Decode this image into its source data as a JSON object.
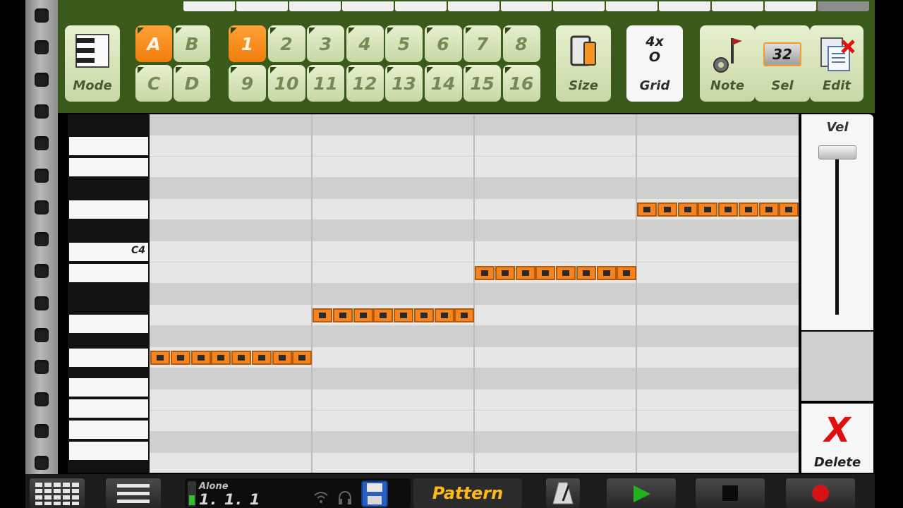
{
  "toolbar": {
    "mode_label": "Mode",
    "patterns": [
      "A",
      "B",
      "C",
      "D"
    ],
    "active_pattern": "A",
    "bars": [
      "1",
      "2",
      "3",
      "4",
      "5",
      "6",
      "7",
      "8",
      "9",
      "10",
      "11",
      "12",
      "13",
      "14",
      "15",
      "16"
    ],
    "active_bar": "1",
    "size_label": "Size",
    "grid_value_top": "4x",
    "grid_value_bottom": "O",
    "grid_label": "Grid",
    "note_label": "Note",
    "sel_value": "32",
    "sel_label": "Sel",
    "edit_label": "Edit"
  },
  "piano": {
    "c4_label": "C4"
  },
  "notes": [
    {
      "row": 11,
      "start_step": 0,
      "length_steps": 8
    },
    {
      "row": 9,
      "start_step": 8,
      "length_steps": 8
    },
    {
      "row": 7,
      "start_step": 16,
      "length_steps": 8
    },
    {
      "row": 4,
      "start_step": 24,
      "length_steps": 8
    }
  ],
  "vel_panel": {
    "label": "Vel"
  },
  "delete": {
    "icon": "X",
    "label": "Delete"
  },
  "bottombar": {
    "song_name": "Alone",
    "song_position": "1. 1. 1",
    "pattern_label": "Pattern"
  },
  "colors": {
    "note": "#f5841e",
    "active": "#f07d0c",
    "toolbar_bg": "#3a5a1c",
    "pattern_text": "#ffb81a",
    "play": "#22b21e",
    "record": "#d41414"
  }
}
